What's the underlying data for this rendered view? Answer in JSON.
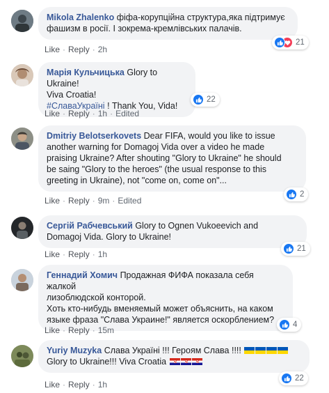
{
  "labels": {
    "like": "Like",
    "reply": "Reply",
    "edited": "Edited",
    "dot": "·"
  },
  "comments": [
    {
      "author": "Mikola Zhalenko",
      "lines": [
        "фіфа-корупційна структура,яка підтримує",
        "фашизм в росії. І зокрема-кремлівських палачів."
      ],
      "time": "2h",
      "edited": false,
      "reactions": {
        "types": [
          "like",
          "love"
        ],
        "count": "21"
      }
    },
    {
      "author": "Марія Кульчицька",
      "lines": [
        "Glory to Ukraine!",
        "Viva Croatia!",
        "#СлаваУкраїні ! Thank You, Vida!"
      ],
      "hashtag": "#СлаваУкраїні",
      "after_hashtag": " ! Thank You, Vida!",
      "time": "1h",
      "edited": true,
      "reactions": {
        "types": [
          "like"
        ],
        "count": "22"
      }
    },
    {
      "author": "Dmitriy Belotserkovets",
      "lines": [
        "Dear FIFA, would you like to issue",
        "another warning for Domagoj Vida over a video he made",
        "praising Ukraine? After shouting \"Glory to Ukraine\" he should",
        "be saing \"Glory to the heroes\" (the usual response to this",
        "greeting in Ukraine), not \"come on, come on\"..."
      ],
      "time": "9m",
      "edited": true,
      "reactions": {
        "types": [
          "like"
        ],
        "count": "2"
      }
    },
    {
      "author": "Сергій Рабчевський",
      "lines": [
        "Glory to Ognen Vukoeevich and",
        "Domagoj Vida. Glory to Ukraine!"
      ],
      "time": "1h",
      "edited": false,
      "reactions": {
        "types": [
          "like"
        ],
        "count": "21"
      }
    },
    {
      "author": "Геннадий Хомич",
      "lines": [
        "Продажная ФИФА показала себя жалкой",
        "лизоблюдской конторой.",
        "Хоть кто-нибудь вменяемый может объяснить, на каком",
        "языке фраза \"Слава Украине!\" является оскорблением?"
      ],
      "time": "15m",
      "edited": false,
      "reactions": {
        "types": [
          "like"
        ],
        "count": "4"
      }
    },
    {
      "author": "Yuriy Muzyka",
      "lines": [
        "Слава Україні !!! Героям Слава !!!!",
        "Glory to Ukraine!!! Viva Croatia"
      ],
      "time": "1h",
      "edited": false,
      "reactions": {
        "types": [
          "like"
        ],
        "count": "22"
      }
    }
  ],
  "colors": {
    "link": "#385898",
    "bubble": "#f2f3f5",
    "like": "#1877f2",
    "love": "#f33e58",
    "meta": "#606770"
  }
}
